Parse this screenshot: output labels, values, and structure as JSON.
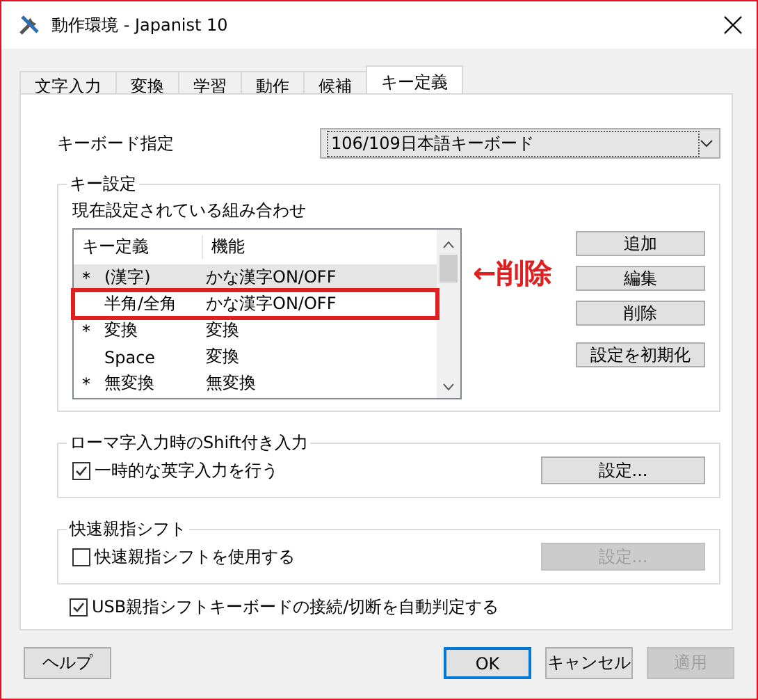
{
  "window": {
    "title": "動作環境 - Japanist 10"
  },
  "tabs": [
    {
      "label": "文字入力",
      "selected": false
    },
    {
      "label": "変換",
      "selected": false
    },
    {
      "label": "学習",
      "selected": false
    },
    {
      "label": "動作",
      "selected": false
    },
    {
      "label": "候補",
      "selected": false
    },
    {
      "label": "キー定義",
      "selected": true
    }
  ],
  "keyboard": {
    "label": "キーボード指定",
    "value": "106/109日本語キーボード"
  },
  "key_settings": {
    "title": "キー設定",
    "list_label": "現在設定されている組み合わせ",
    "columns": [
      "キー定義",
      "機能"
    ],
    "rows": [
      {
        "mark": "*",
        "key": "(漢字)",
        "function": "かな漢字ON/OFF",
        "selected": true,
        "highlighted": false
      },
      {
        "mark": "",
        "key": "半角/全角",
        "function": "かな漢字ON/OFF",
        "selected": false,
        "highlighted": true
      },
      {
        "mark": "*",
        "key": "変換",
        "function": "変換",
        "selected": false,
        "highlighted": false
      },
      {
        "mark": "",
        "key": "Space",
        "function": "変換",
        "selected": false,
        "highlighted": false
      },
      {
        "mark": "*",
        "key": "無変換",
        "function": "無変換",
        "selected": false,
        "highlighted": false
      }
    ],
    "annotation": "←削除",
    "buttons": [
      "追加",
      "編集",
      "削除",
      "設定を初期化"
    ]
  },
  "groups": [
    {
      "title": "ローマ字入力時のShift付き入力",
      "checkbox": {
        "label": "一時的な英字入力を行う",
        "checked": true
      },
      "button": {
        "label": "設定...",
        "disabled": false
      }
    },
    {
      "title": "快速親指シフト",
      "checkbox": {
        "label": "快速親指シフトを使用する",
        "checked": false
      },
      "button": {
        "label": "設定...",
        "disabled": true
      }
    }
  ],
  "usb_checkbox": {
    "label": "USB親指シフトキーボードの接続/切断を自動判定する",
    "checked": true
  },
  "footer": {
    "help": "ヘルプ",
    "buttons": [
      {
        "label": "OK",
        "kind": "default",
        "disabled": false
      },
      {
        "label": "キャンセル",
        "kind": "normal",
        "disabled": false
      },
      {
        "label": "適用",
        "kind": "normal",
        "disabled": true
      }
    ]
  }
}
